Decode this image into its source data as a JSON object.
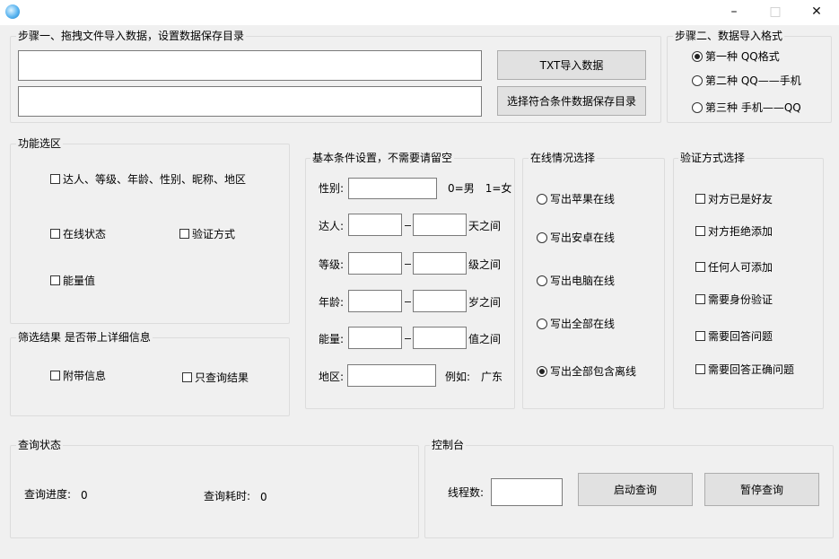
{
  "window": {
    "minimize": "–",
    "maximize": "□",
    "close": "✕"
  },
  "step1": {
    "title": "步骤一、拖拽文件导入数据，设置数据保存目录",
    "import_button": "TXT导入数据",
    "save_dir_button": "选择符合条件数据保存目录",
    "import_path": "",
    "save_path": ""
  },
  "step2": {
    "title": "步骤二、数据导入格式",
    "options": [
      {
        "label": "第一种 QQ格式",
        "checked": true
      },
      {
        "label": "第二种 QQ——手机",
        "checked": false
      },
      {
        "label": "第三种 手机——QQ",
        "checked": false
      }
    ]
  },
  "features": {
    "title": "功能选区",
    "items": [
      {
        "label": "达人、等级、年龄、性别、昵称、地区",
        "checked": false
      },
      {
        "label": "在线状态",
        "checked": false
      },
      {
        "label": "验证方式",
        "checked": false
      },
      {
        "label": "能量值",
        "checked": false
      }
    ]
  },
  "filter": {
    "title": "筛选结果 是否带上详细信息",
    "items": [
      {
        "label": "附带信息",
        "checked": false
      },
      {
        "label": "只查询结果",
        "checked": false
      }
    ]
  },
  "basic": {
    "title": "基本条件设置，不需要请留空",
    "gender": {
      "label": "性别:",
      "value": "",
      "hint": "0=男　1=女"
    },
    "rows": [
      {
        "label": "达人:",
        "min": "",
        "max": "",
        "suffix": "天之间"
      },
      {
        "label": "等级:",
        "min": "",
        "max": "",
        "suffix": "级之间"
      },
      {
        "label": "年龄:",
        "min": "",
        "max": "",
        "suffix": "岁之间"
      },
      {
        "label": "能量:",
        "min": "",
        "max": "",
        "suffix": "值之间"
      }
    ],
    "region": {
      "label": "地区:",
      "value": "",
      "hint": "例如:　广东"
    }
  },
  "online": {
    "title": "在线情况选择",
    "options": [
      {
        "label": "写出苹果在线",
        "checked": false
      },
      {
        "label": "写出安卓在线",
        "checked": false
      },
      {
        "label": "写出电脑在线",
        "checked": false
      },
      {
        "label": "写出全部在线",
        "checked": false
      },
      {
        "label": "写出全部包含离线",
        "checked": true
      }
    ]
  },
  "verify": {
    "title": "验证方式选择",
    "items": [
      {
        "label": "对方已是好友",
        "checked": false
      },
      {
        "label": "对方拒绝添加",
        "checked": false
      },
      {
        "label": "任何人可添加",
        "checked": false
      },
      {
        "label": "需要身份验证",
        "checked": false
      },
      {
        "label": "需要回答问题",
        "checked": false
      },
      {
        "label": "需要回答正确问题",
        "checked": false
      }
    ]
  },
  "status": {
    "title": "查询状态",
    "progress_label": "查询进度:",
    "progress_value": "0",
    "time_label": "查询耗时:",
    "time_value": "0"
  },
  "console": {
    "title": "控制台",
    "threads_label": "线程数:",
    "threads_value": "",
    "start_button": "启动查询",
    "pause_button": "暂停查询"
  }
}
